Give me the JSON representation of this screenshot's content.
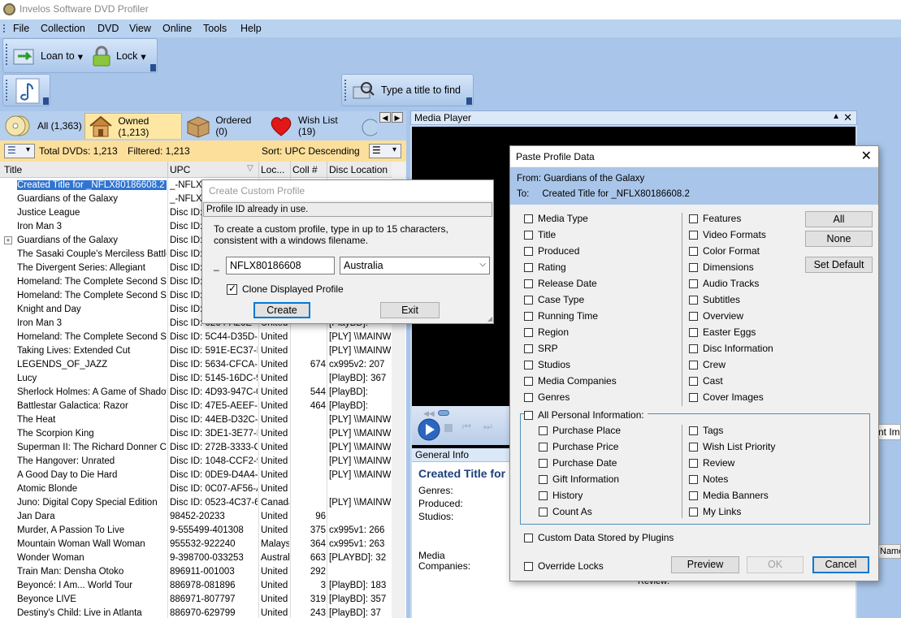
{
  "app": {
    "title": "Invelos Software DVD Profiler"
  },
  "menu": [
    "File",
    "Collection",
    "DVD",
    "View",
    "Online",
    "Tools",
    "Help"
  ],
  "toolbar": {
    "loan_to": "Loan to",
    "lock": "Lock",
    "find_placeholder": "Type a title to find"
  },
  "tabs": [
    {
      "label": "All (1,363)",
      "icon": "discs-icon"
    },
    {
      "label": "Owned (1,213)",
      "icon": "house-icon"
    },
    {
      "label": "Ordered (0)",
      "icon": "box-icon"
    },
    {
      "label": "Wish List (19)",
      "icon": "heart-icon"
    }
  ],
  "summary": {
    "total": "Total DVDs: 1,213",
    "filtered": "Filtered: 1,213",
    "sort": "Sort: UPC Descending"
  },
  "grid": {
    "headers": [
      "Title",
      "UPC",
      "Loc...",
      "Coll #",
      "Disc Location"
    ],
    "rows": [
      {
        "title": "Created Title for _NFLX80186608.2",
        "upc": "_-NFLX8",
        "loc": "",
        "coll": "",
        "disc": ""
      },
      {
        "title": "Guardians of the Galaxy",
        "upc": "_-NFLX8",
        "loc": "",
        "coll": "",
        "disc": ""
      },
      {
        "title": "Justice League",
        "upc": "Disc ID:",
        "loc": "",
        "coll": "",
        "disc": ""
      },
      {
        "title": "Iron Man 3",
        "upc": "Disc ID:",
        "loc": "",
        "coll": "",
        "disc": ""
      },
      {
        "title": "Guardians of the Galaxy",
        "upc": "Disc ID:",
        "loc": "",
        "coll": "",
        "disc": ""
      },
      {
        "title": "The Sasaki Couple's Merciless Battle",
        "upc": "Disc ID:",
        "loc": "",
        "coll": "",
        "disc": ""
      },
      {
        "title": "The Divergent Series: Allegiant",
        "upc": "Disc ID:",
        "loc": "",
        "coll": "",
        "disc": ""
      },
      {
        "title": "Homeland: The Complete Second Seas",
        "upc": "Disc ID:",
        "loc": "",
        "coll": "",
        "disc": ""
      },
      {
        "title": "Homeland: The Complete Second Seas",
        "upc": "Disc ID:",
        "loc": "",
        "coll": "",
        "disc": ""
      },
      {
        "title": "Knight and Day",
        "upc": "Disc ID:",
        "loc": "",
        "coll": "",
        "disc": ""
      },
      {
        "title": "Iron Man 3",
        "upc": "Disc ID: 0264-A26E-4",
        "loc": "United",
        "coll": "",
        "disc": "[PlayBD]:"
      },
      {
        "title": "Homeland: The Complete Second Seas",
        "upc": "Disc ID: 5C44-D35D-E",
        "loc": "United",
        "coll": "",
        "disc": "[PLY] \\\\MAINW"
      },
      {
        "title": "Taking Lives: Extended Cut",
        "upc": "Disc ID: 591E-EC37-B8",
        "loc": "United",
        "coll": "",
        "disc": "[PLY] \\\\MAINW"
      },
      {
        "title": "LEGENDS_OF_JAZZ",
        "upc": "Disc ID: 5634-CFCA-2",
        "loc": "United",
        "coll": "674",
        "disc": "cx995v2: 207"
      },
      {
        "title": "Lucy",
        "upc": "Disc ID: 5145-16DC-9",
        "loc": "United",
        "coll": "",
        "disc": "[PlayBD]: 367"
      },
      {
        "title": "Sherlock Holmes: A Game of Shadows",
        "upc": "Disc ID: 4D93-947C-0F",
        "loc": "United",
        "coll": "544",
        "disc": "[PlayBD]:"
      },
      {
        "title": "Battlestar Galactica: Razor",
        "upc": "Disc ID: 47E5-AEEF-4",
        "loc": "United",
        "coll": "464",
        "disc": "[PlayBD]:"
      },
      {
        "title": "The Heat",
        "upc": "Disc ID: 44EB-D32C-5",
        "loc": "United",
        "coll": "",
        "disc": "[PLY] \\\\MAINW"
      },
      {
        "title": "The Scorpion King",
        "upc": "Disc ID: 3DE1-3E77-E6",
        "loc": "United",
        "coll": "",
        "disc": "[PLY] \\\\MAINW"
      },
      {
        "title": "Superman II: The Richard Donner Cut",
        "upc": "Disc ID: 272B-3333-C1",
        "loc": "United",
        "coll": "",
        "disc": "[PLY] \\\\MAINW"
      },
      {
        "title": "The Hangover: Unrated",
        "upc": "Disc ID: 1048-CCF2-9",
        "loc": "United",
        "coll": "",
        "disc": "[PLY] \\\\MAINW"
      },
      {
        "title": "A Good Day to Die Hard",
        "upc": "Disc ID: 0DE9-D4A4-2",
        "loc": "United",
        "coll": "",
        "disc": "[PLY] \\\\MAINW"
      },
      {
        "title": "Atomic Blonde",
        "upc": "Disc ID: 0C07-AF56-A",
        "loc": "United",
        "coll": "",
        "disc": ""
      },
      {
        "title": "Juno: Digital Copy Special Edition",
        "upc": "Disc ID: 0523-4C37-67",
        "loc": "Canada",
        "coll": "",
        "disc": "[PLY] \\\\MAINW"
      },
      {
        "title": "Jan Dara",
        "upc": "98452-20233",
        "loc": "United",
        "coll": "96",
        "disc": ""
      },
      {
        "title": "Murder, A Passion To Live",
        "upc": "9-555499-401308",
        "loc": "United",
        "coll": "375",
        "disc": "cx995v1: 266"
      },
      {
        "title": "Mountain Woman Wall Woman",
        "upc": "955532-922240",
        "loc": "Malaysi",
        "coll": "364",
        "disc": "cx995v1: 263"
      },
      {
        "title": "Wonder Woman",
        "upc": "9-398700-033253",
        "loc": "Austral",
        "coll": "663",
        "disc": "[PLAYBD]: 32"
      },
      {
        "title": "Train Man: Densha Otoko",
        "upc": "896911-001003",
        "loc": "United",
        "coll": "292",
        "disc": ""
      },
      {
        "title": "Beyoncé: I Am... World Tour",
        "upc": "886978-081896",
        "loc": "United",
        "coll": "3",
        "disc": "[PlayBD]: 183"
      },
      {
        "title": "Beyonce LIVE",
        "upc": "886971-807797",
        "loc": "United",
        "coll": "319",
        "disc": "[PlayBD]: 357"
      },
      {
        "title": "Destiny's Child: Live in Atlanta",
        "upc": "886970-629799",
        "loc": "United",
        "coll": "243",
        "disc": "[PlayBD]: 37"
      }
    ]
  },
  "media_player": {
    "title": "Media Player"
  },
  "general_info": {
    "header": "General Info",
    "title": "Created Title for",
    "labels": [
      "Genres:",
      "Produced:",
      "Studios:",
      "Media",
      "Companies:"
    ],
    "review": "Review:",
    "right_cut": "nt Ima",
    "name_cut": "Name"
  },
  "custom_profile": {
    "title": "Create Custom Profile",
    "error": "Profile ID already in use.",
    "instructions": "To create a custom profile, type in up to 15 characters, consistent with a windows filename.",
    "prefix": "_",
    "id_value": "NFLX80186608",
    "country": "Australia",
    "clone_label": "Clone Displayed Profile",
    "create": "Create",
    "exit": "Exit"
  },
  "paste_profile": {
    "title": "Paste Profile Data",
    "from": "From:  Guardians of the Galaxy",
    "to": "To:     Created Title for _NFLX80186608.2",
    "left_items": [
      "Media Type",
      "Title",
      "Produced",
      "Rating",
      "Release Date",
      "Case Type",
      "Running Time",
      "Region",
      "SRP",
      "Studios",
      "Media Companies",
      "Genres"
    ],
    "right_items": [
      "Features",
      "Video Formats",
      "Color Format",
      "Dimensions",
      "Audio Tracks",
      "Subtitles",
      "Overview",
      "Easter Eggs",
      "Disc Information",
      "Crew",
      "Cast",
      "Cover Images"
    ],
    "all_personal": "All Personal Information:",
    "personal_left": [
      "Purchase Place",
      "Purchase Price",
      "Purchase Date",
      "Gift Information",
      "History",
      "Count As"
    ],
    "personal_right": [
      "Tags",
      "Wish List Priority",
      "Review",
      "Notes",
      "Media Banners",
      "My Links"
    ],
    "custom_data": "Custom Data Stored by Plugins",
    "override": "Override Locks",
    "buttons": {
      "all": "All",
      "none": "None",
      "set_default": "Set Default",
      "preview": "Preview",
      "ok": "OK",
      "cancel": "Cancel"
    }
  }
}
